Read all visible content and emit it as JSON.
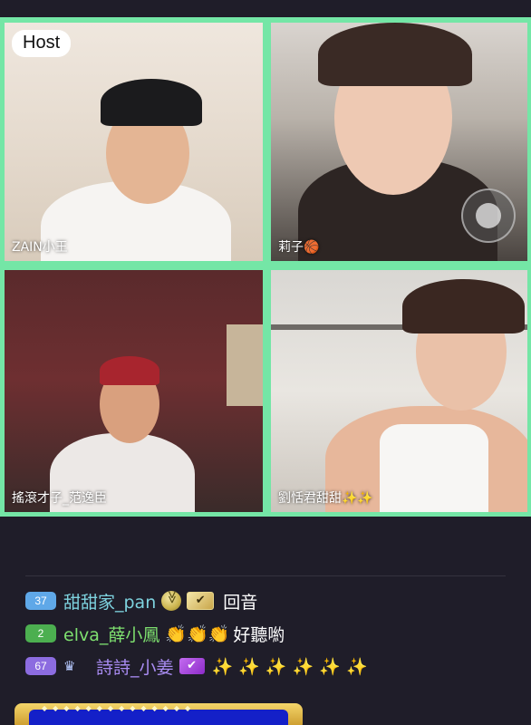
{
  "video_grid": {
    "tiles": [
      {
        "name": "ZAIN小王",
        "badge": "Host"
      },
      {
        "name": "莉子🏀"
      },
      {
        "name": "搖滾才子_范逸臣"
      },
      {
        "name": "劉恬君甜甜✨✨"
      }
    ]
  },
  "chat": {
    "messages": [
      {
        "level": "37",
        "level_color": "#5fa8e8",
        "username": "甜甜家_pan",
        "username_color": "#7ed3df",
        "icons": [
          "shield-rank-icon",
          "verified-badge-icon"
        ],
        "text": "回音"
      },
      {
        "level": "2",
        "level_color": "#4caf50",
        "username": "elva_薛小鳳",
        "username_color": "#7ee06f",
        "emojis": "👏👏👏",
        "text": "好聽喲"
      },
      {
        "level": "67",
        "level_color": "#8c6ce0",
        "username": "詩詩_小姜",
        "username_color": "#a98cf2",
        "icons": [
          "crown-icon",
          "verified-badge-icon"
        ],
        "emojis": "✨ ✨ ✨ ✨ ✨ ✨"
      }
    ]
  },
  "colors": {
    "background": "#1f1d29",
    "grid_border": "#74e6a6"
  }
}
